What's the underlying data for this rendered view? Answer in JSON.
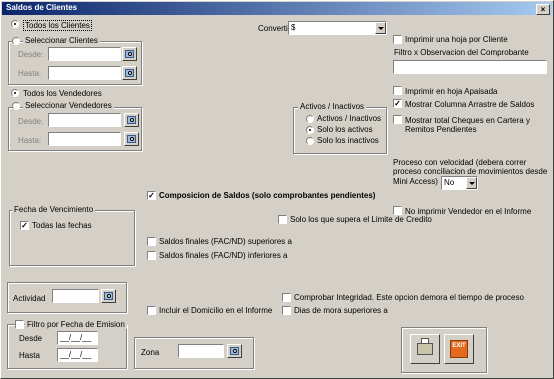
{
  "window": {
    "title": "Saldos de Clientes",
    "close_label": "×"
  },
  "clientes": {
    "todos": "Todos los Clientes",
    "seleccionar": "Seleccionar Clientes",
    "desde": "Desde:",
    "hasta": "Hasta:"
  },
  "vendedores": {
    "todos": "Todos los Vendedores",
    "seleccionar": "Seleccionar Vendedores",
    "desde": "Desde:",
    "hasta": "Hasta:"
  },
  "convertir": {
    "label": "Convertir a",
    "value": "$"
  },
  "activos": {
    "legend": "Activos / Inactivos",
    "options": [
      "Activos / Inactivos",
      "Solo los activos",
      "Solo los inactivos"
    ]
  },
  "right_options": {
    "imprimir_hoja": "Imprimir una hoja por Cliente",
    "filtro_label": "Filtro x Observacion del Comprobante",
    "filtro_value": "",
    "apaisada": "Imprimir en hoja Apaisada",
    "arrastre": "Mostrar Columna Arrastre de Saldos",
    "cheques_1": "Mostrar total Cheques en Cartera y",
    "cheques_2": "Remitos Pendientes",
    "velocidad_1": "Proceso con velocidad (debera correr",
    "velocidad_2": "proceso conciliacion de movimientos desde",
    "velocidad_3": "Mini Access)",
    "velocidad_value": "No",
    "no_vendedor": "No imprimir Vendedor en el Informe"
  },
  "composicion": "Composicion de Saldos (solo comprobantes pendientes)",
  "vencimiento": {
    "legend": "Fecha de Vencimiento",
    "todas": "Todas las fechas"
  },
  "limite": "Solo los que supera el Limite de Credito",
  "saldos_sup": "Saldos finales (FAC/ND) superiores a",
  "saldos_inf": "Saldos finales (FAC/ND) inferiores a",
  "actividad": {
    "label": "Actividad",
    "value": ""
  },
  "domicilio": "Incluir el Domicilio en el Informe",
  "integridad": "Comprobar Integridad. Este opcion demora el tiempo de proceso",
  "dias_mora": "Dias de mora superiores a",
  "emision": {
    "legend": "Filtro por Fecha de Emision",
    "desde": "Desde",
    "hasta": "Hasta",
    "desde_value": "__/__/__",
    "hasta_value": "__/__/__"
  },
  "zona": {
    "label": "Zona",
    "value": ""
  },
  "buttons": {
    "print_icon": "printer-icon",
    "exit_icon": "exit-icon",
    "exit_text": "EXIT"
  }
}
